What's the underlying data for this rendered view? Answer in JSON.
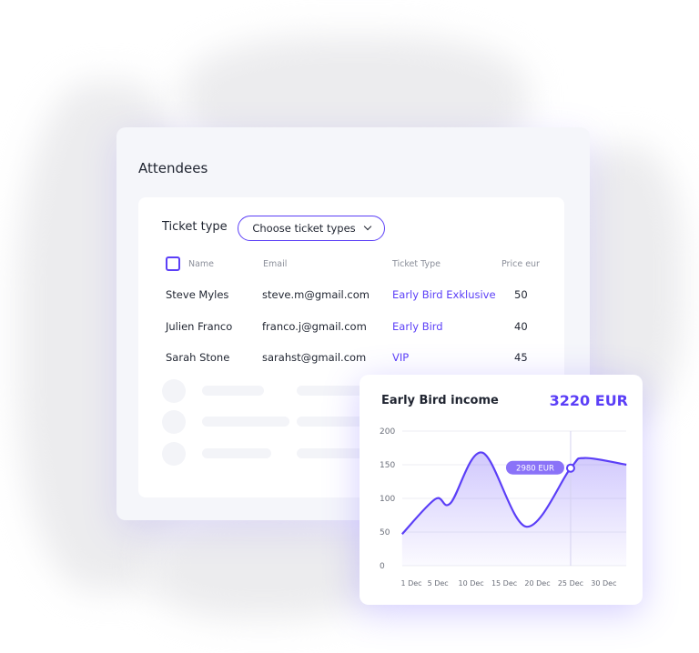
{
  "attendees": {
    "title": "Attendees",
    "ticket_type_label": "Ticket type",
    "dropdown_label": "Choose ticket types",
    "columns": [
      "Name",
      "Email",
      "Ticket Type",
      "Price eur"
    ],
    "rows": [
      {
        "name": "Steve Myles",
        "email": "steve.m@gmail.com",
        "type": "Early Bird Exklusive",
        "price": "50"
      },
      {
        "name": "Julien Franco",
        "email": "franco.j@gmail.com",
        "type": "Early Bird",
        "price": "40"
      },
      {
        "name": "Sarah Stone",
        "email": "sarahst@gmail.com",
        "type": "VIP",
        "price": "45"
      }
    ]
  },
  "colors": {
    "accent": "#5b3ff7",
    "tooltip": "#8a72f8"
  },
  "chart_data": {
    "type": "area",
    "title": "Early Bird income",
    "total": "3220 EUR",
    "x_tick_labels": [
      "1 Dec",
      "5 Dec",
      "10 Dec",
      "15 Dec",
      "20 Dec",
      "25 Dec",
      "30 Dec"
    ],
    "x_tick_days": [
      1,
      5,
      10,
      15,
      20,
      25,
      30
    ],
    "y_ticks": [
      0,
      50,
      100,
      150,
      200
    ],
    "ylim": [
      0,
      200
    ],
    "grid": true,
    "points": [
      {
        "day": -0.4,
        "value": 47
      },
      {
        "day": 4.6,
        "value": 99
      },
      {
        "day": 6.9,
        "value": 93
      },
      {
        "day": 11.7,
        "value": 168
      },
      {
        "day": 18.3,
        "value": 58
      },
      {
        "day": 25,
        "value": 145
      },
      {
        "day": 27.1,
        "value": 160
      },
      {
        "day": 33.4,
        "value": 150
      }
    ],
    "highlight": {
      "day": 25,
      "value": 145,
      "label": "2980 EUR"
    }
  }
}
